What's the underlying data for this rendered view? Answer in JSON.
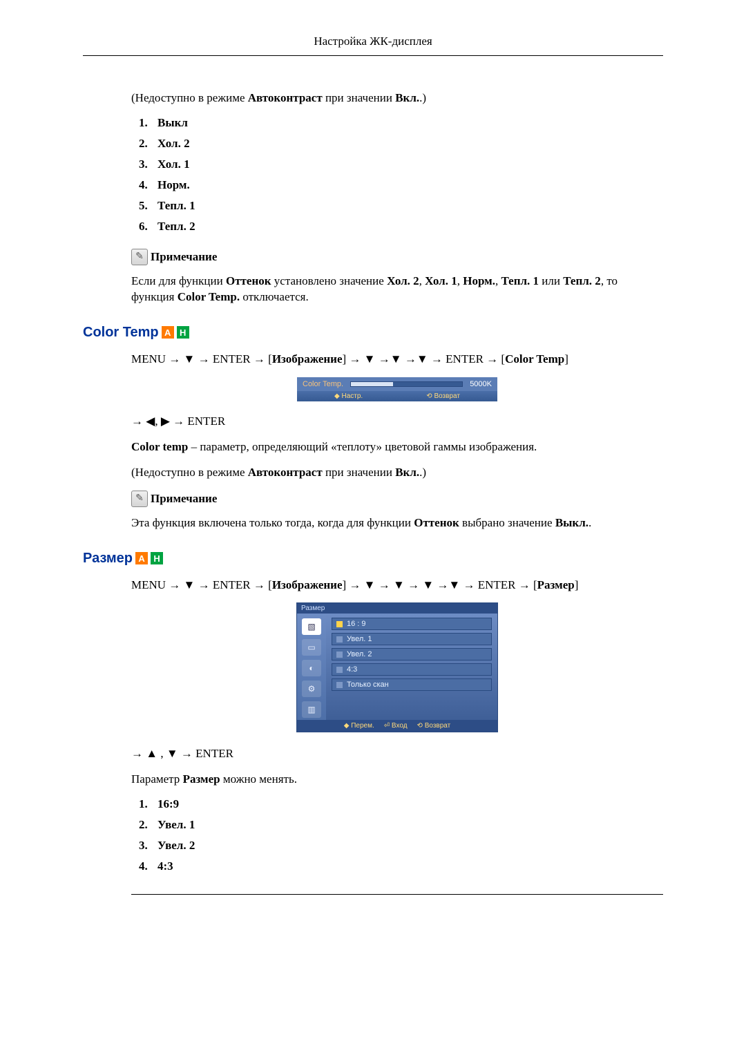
{
  "header": {
    "title": "Настройка ЖК-дисплея"
  },
  "intro": {
    "unavailable": "(Недоступно в режиме ",
    "autocontrast": "Автоконтраст",
    "when_value": " при значении ",
    "on": "Вкл.",
    "tail": ".)"
  },
  "options_list1": [
    "Выкл",
    "Хол. 2",
    "Хол. 1",
    "Норм.",
    "Тепл. 1",
    "Тепл. 2"
  ],
  "note_label": "Примечание",
  "note1": {
    "prefix": "Если для функции ",
    "ottenok": "Оттенок",
    "mid1": " установлено значение ",
    "v1": "Хол. 2",
    "sep": ", ",
    "v2": "Хол. 1",
    "v3": "Норм.",
    "v4": "Тепл. 1",
    "or": " или ",
    "v5": "Тепл. 2",
    "mid2": ", то функция ",
    "ct": "Color Temp.",
    "tail": " отключается."
  },
  "section_colortemp": {
    "title": "Color Temp",
    "menu_line": {
      "t0": "MENU → ▼ → ENTER → [",
      "img": "Изображение",
      "t1": "] → ▼ →▼ →▼ → ENTER → [",
      "ct": "Color Temp",
      "t2": "]"
    },
    "osd": {
      "label": "Color Temp.",
      "value": "5000K",
      "nav_adjust": "◆ Настр.",
      "nav_return": "⟲ Возврат"
    },
    "after_osd": "→ ◀, ▶ → ENTER",
    "desc": {
      "lead": "Color temp",
      "rest": " – параметр, определяющий «теплоту» цветовой гаммы изображения."
    },
    "note_text": {
      "p0": "Эта функция включена только тогда, когда для функции ",
      "ottenok": "Оттенок",
      "p1": " выбрано значение ",
      "off": "Выкл.",
      "p2": "."
    }
  },
  "section_size": {
    "title": "Размер",
    "menu_line": {
      "t0": "MENU → ▼ → ENTER → [",
      "img": "Изображение",
      "t1": "] → ▼ → ▼ → ▼ →▼ → ENTER → [",
      "sz": "Размер",
      "t2": "]"
    },
    "osd": {
      "title": "Размер",
      "opts": [
        "16 : 9",
        "Увел. 1",
        "Увел. 2",
        "4:3",
        "Только скан"
      ],
      "footer_move": "◆ Перем.",
      "footer_enter": "⏎ Вход",
      "footer_return": "⟲ Возврат"
    },
    "after_osd": "→ ▲ , ▼ → ENTER",
    "desc": {
      "p0": "Параметр ",
      "sz": "Размер",
      "p1": " можно менять."
    },
    "list": [
      "16:9",
      "Увел. 1",
      "Увел. 2",
      "4:3"
    ]
  }
}
